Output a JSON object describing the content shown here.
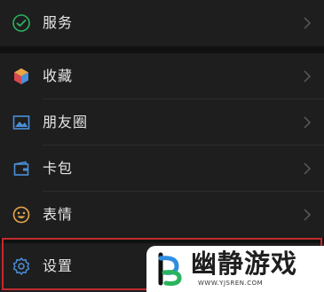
{
  "menu": {
    "items": [
      {
        "label": "服务",
        "icon": "wechat-pay-icon",
        "color": "#2ab35e"
      },
      {
        "label": "收藏",
        "icon": "cube-icon",
        "color": "#e8a64a"
      },
      {
        "label": "朋友圈",
        "icon": "photo-icon",
        "color": "#4a8fd9"
      },
      {
        "label": "卡包",
        "icon": "wallet-icon",
        "color": "#4a8fd9"
      },
      {
        "label": "表情",
        "icon": "smiley-icon",
        "color": "#e8a64a"
      },
      {
        "label": "设置",
        "icon": "gear-icon",
        "color": "#4a8fd9"
      }
    ],
    "highlight_color": "#c22a2e"
  },
  "watermark": {
    "brand": "幽静游戏",
    "url": "WWW.YJSREN.COM"
  }
}
